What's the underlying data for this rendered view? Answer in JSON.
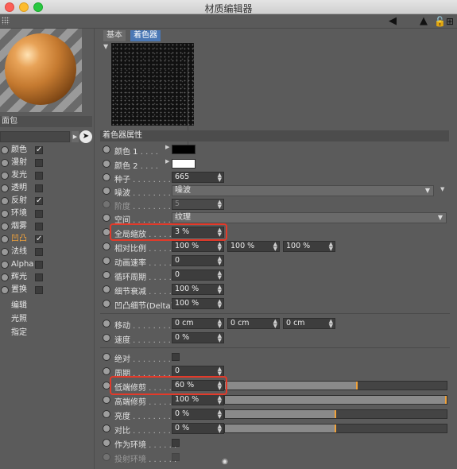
{
  "window": {
    "title": "材质编辑器"
  },
  "left": {
    "material_name": "面包",
    "channels": [
      {
        "label": "颜色",
        "checked": true,
        "active": false
      },
      {
        "label": "漫射",
        "checked": false,
        "active": false
      },
      {
        "label": "发光",
        "checked": false,
        "active": false
      },
      {
        "label": "透明",
        "checked": false,
        "active": false
      },
      {
        "label": "反射",
        "checked": true,
        "active": false
      },
      {
        "label": "环境",
        "checked": false,
        "active": false
      },
      {
        "label": "烟雾",
        "checked": false,
        "active": false
      },
      {
        "label": "凹凸",
        "checked": true,
        "active": true
      },
      {
        "label": "法线",
        "checked": false,
        "active": false
      },
      {
        "label": "Alpha",
        "checked": false,
        "active": false
      },
      {
        "label": "辉光",
        "checked": false,
        "active": false
      },
      {
        "label": "置换",
        "checked": false,
        "active": false
      }
    ],
    "sub_items": [
      "编辑",
      "光照",
      "指定"
    ]
  },
  "tabs": {
    "basic": "基本",
    "shader": "着色器"
  },
  "section": {
    "title": "着色器属性"
  },
  "props": {
    "color1": {
      "label": "颜色 1",
      "color": "#000000"
    },
    "color2": {
      "label": "颜色 2",
      "color": "#ffffff"
    },
    "seed": {
      "label": "种子",
      "value": "665"
    },
    "noise": {
      "label": "噪波",
      "value": "噪波"
    },
    "octaves": {
      "label": "阶度",
      "value": "5"
    },
    "space": {
      "label": "空间",
      "value": "纹理"
    },
    "global_scale": {
      "label": "全局缩放",
      "value": "3 %"
    },
    "relative_scale": {
      "label": "相对比例",
      "values": [
        "100 %",
        "100 %",
        "100 %"
      ]
    },
    "anim_speed": {
      "label": "动画速率",
      "value": "0"
    },
    "loop_period": {
      "label": "循环周期",
      "value": "0"
    },
    "detail_atten": {
      "label": "细节衰减",
      "value": "100 %"
    },
    "bump_detail": {
      "label": "凹凸细节(Delta)",
      "value": "100 %"
    },
    "move": {
      "label": "移动",
      "values": [
        "0 cm",
        "0 cm",
        "0 cm"
      ]
    },
    "speed": {
      "label": "速度",
      "value": "0 %"
    },
    "absolute": {
      "label": "绝对",
      "checked": false
    },
    "cycles": {
      "label": "周期",
      "value": "0"
    },
    "low_clip": {
      "label": "低端修剪",
      "value": "60 %",
      "level": 0.6
    },
    "high_clip": {
      "label": "高端修剪",
      "value": "100 %",
      "level": 1.0
    },
    "brightness": {
      "label": "亮度",
      "value": "0 %",
      "level": 0.5
    },
    "contrast": {
      "label": "对比",
      "value": "0 %",
      "level": 0.5
    },
    "as_env": {
      "label": "作为环境",
      "checked": false
    },
    "project_env": {
      "label": "投射环境",
      "checked": false
    }
  },
  "colors": {
    "accent_orange": "#f0a23a",
    "highlight_red": "#e33a2a",
    "tab_active": "#4b78b5"
  },
  "icons": [
    "grid-icon",
    "back-arrow-icon",
    "cursor-icon",
    "lock-icon",
    "new-window-icon"
  ]
}
